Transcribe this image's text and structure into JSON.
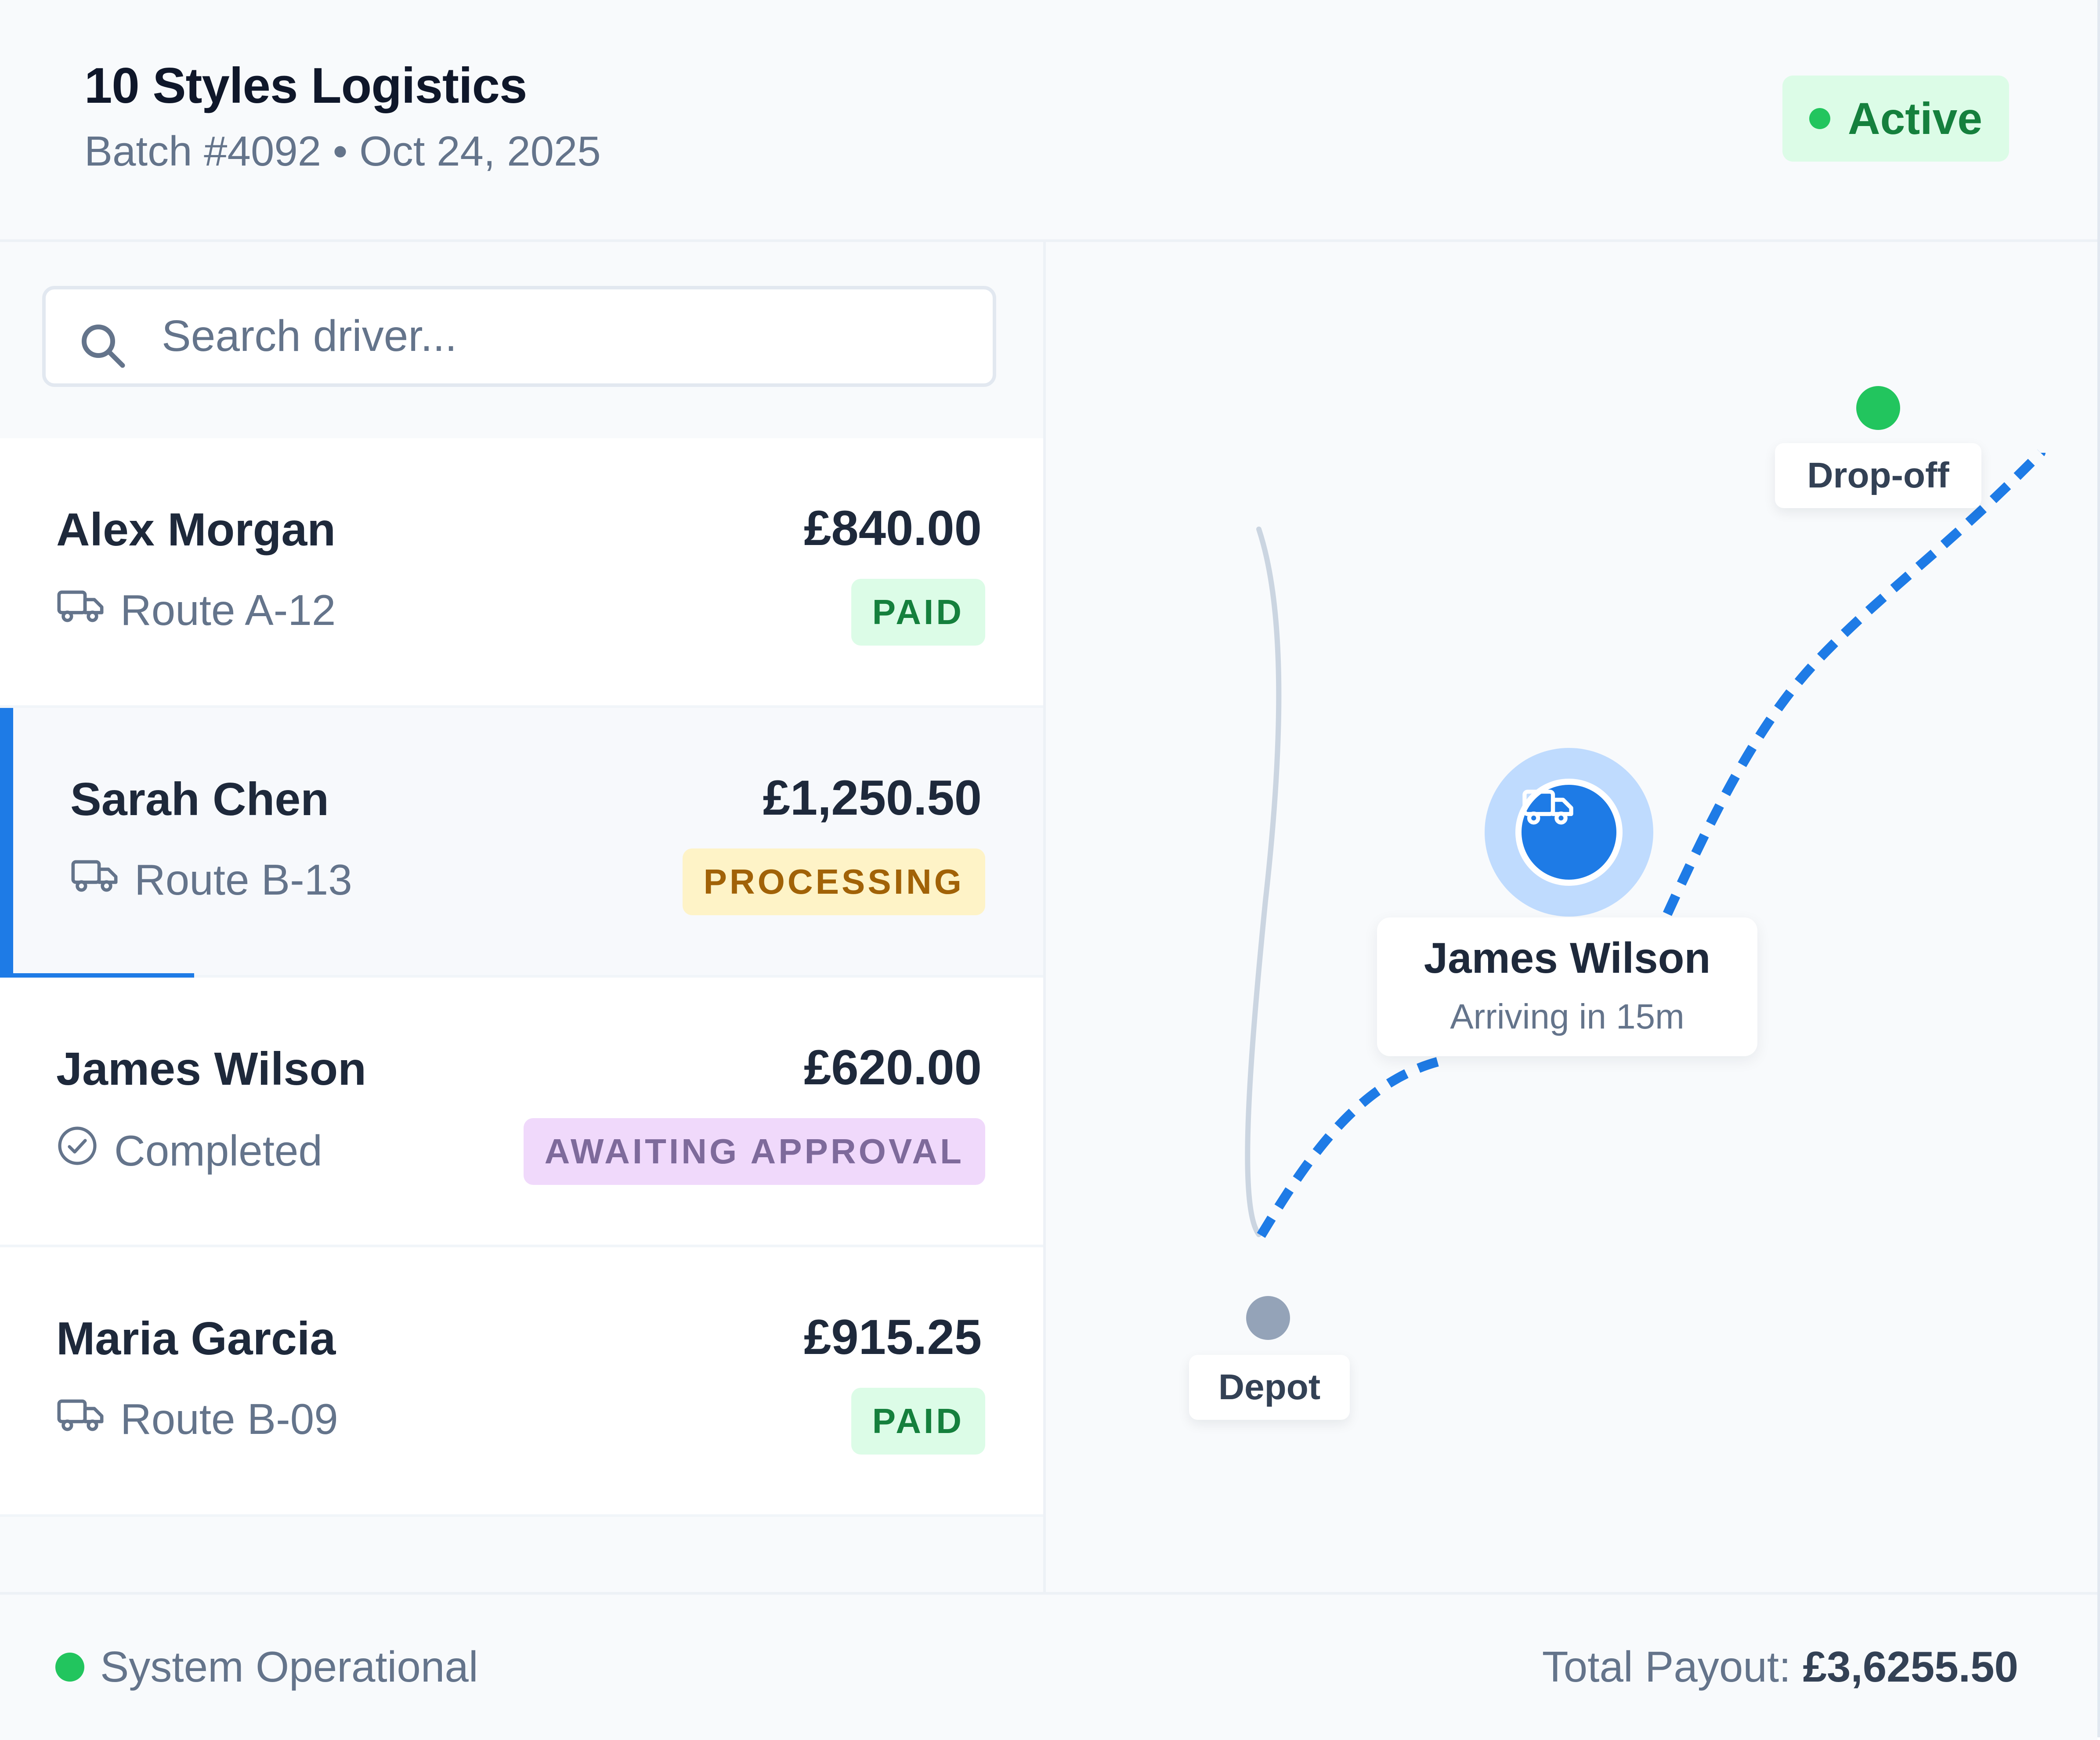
{
  "header": {
    "brand": "10 Styles Logistics",
    "batch": "Batch #4092 • Oct 24, 2025",
    "status": "Active"
  },
  "search": {
    "placeholder": "Search driver..."
  },
  "drivers": [
    {
      "name": "Alex Morgan",
      "amount": "£840.00",
      "sub": "Route A-12",
      "sub_icon": "truck-icon",
      "badge": "PAID"
    },
    {
      "name": "Sarah Chen",
      "amount": "£1,250.50",
      "sub": "Route B-13",
      "sub_icon": "truck-icon",
      "badge": "PROCESSING",
      "selected": true
    },
    {
      "name": "James Wilson",
      "amount": "£620.00",
      "sub": "Completed",
      "sub_icon": "check-circle-icon",
      "badge": "AWAITING APPROVAL"
    },
    {
      "name": "Maria Garcia",
      "amount": "£915.25",
      "sub": "Route B-09",
      "sub_icon": "truck-icon",
      "badge": "PAID"
    }
  ],
  "map": {
    "dropoff_label": "Drop-off",
    "depot_label": "Depot",
    "driver_name": "James Wilson",
    "driver_eta": "Arriving in 15m"
  },
  "footer": {
    "system_status": "System Operational",
    "payout_label": "Total Payout:",
    "payout_value": "£3,6255.50"
  },
  "colors": {
    "accent": "#1e7be6",
    "success": "#22c55e",
    "paid_bg": "#dcfce7",
    "processing_bg": "#fef3c7",
    "awaiting_bg": "#f0d9fb"
  }
}
